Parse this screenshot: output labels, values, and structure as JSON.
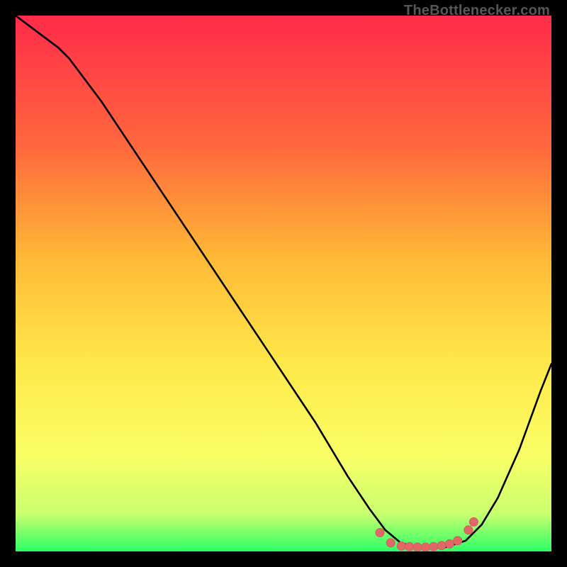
{
  "watermark": "TheBottlenecker.com",
  "colors": {
    "black": "#000000",
    "curve": "#000000",
    "markers_fill": "#e06868",
    "markers_stroke": "#d85a5a",
    "gradient_top": "#ff2b4a",
    "gradient_mid1": "#ff6a3d",
    "gradient_mid2": "#ffb836",
    "gradient_mid3": "#ffe84a",
    "gradient_mid4": "#faff66",
    "gradient_bottom1": "#c9ff6f",
    "gradient_bottom2": "#2bff66"
  },
  "chart_data": {
    "type": "line",
    "title": "",
    "xlabel": "",
    "ylabel": "",
    "xlim": [
      0,
      100
    ],
    "ylim": [
      0,
      100
    ],
    "curve": [
      {
        "x": 0,
        "y": 100
      },
      {
        "x": 4,
        "y": 97
      },
      {
        "x": 8,
        "y": 94
      },
      {
        "x": 10,
        "y": 92
      },
      {
        "x": 16,
        "y": 84
      },
      {
        "x": 24,
        "y": 72
      },
      {
        "x": 32,
        "y": 60
      },
      {
        "x": 40,
        "y": 48
      },
      {
        "x": 48,
        "y": 36
      },
      {
        "x": 56,
        "y": 24
      },
      {
        "x": 62,
        "y": 14
      },
      {
        "x": 66,
        "y": 8
      },
      {
        "x": 69,
        "y": 4
      },
      {
        "x": 72,
        "y": 1.5
      },
      {
        "x": 76,
        "y": 0.7
      },
      {
        "x": 80,
        "y": 0.7
      },
      {
        "x": 84,
        "y": 2
      },
      {
        "x": 87,
        "y": 5
      },
      {
        "x": 90,
        "y": 10
      },
      {
        "x": 94,
        "y": 19
      },
      {
        "x": 98,
        "y": 30
      },
      {
        "x": 100,
        "y": 35
      }
    ],
    "markers": [
      {
        "x": 68,
        "y": 3.5
      },
      {
        "x": 70,
        "y": 1.6
      },
      {
        "x": 72,
        "y": 1.0
      },
      {
        "x": 73.5,
        "y": 0.9
      },
      {
        "x": 75,
        "y": 0.8
      },
      {
        "x": 76.5,
        "y": 0.8
      },
      {
        "x": 78,
        "y": 0.9
      },
      {
        "x": 79.5,
        "y": 1.1
      },
      {
        "x": 81,
        "y": 1.4
      },
      {
        "x": 82.5,
        "y": 2.0
      },
      {
        "x": 84.5,
        "y": 4.0
      },
      {
        "x": 85.5,
        "y": 5.5
      }
    ]
  }
}
